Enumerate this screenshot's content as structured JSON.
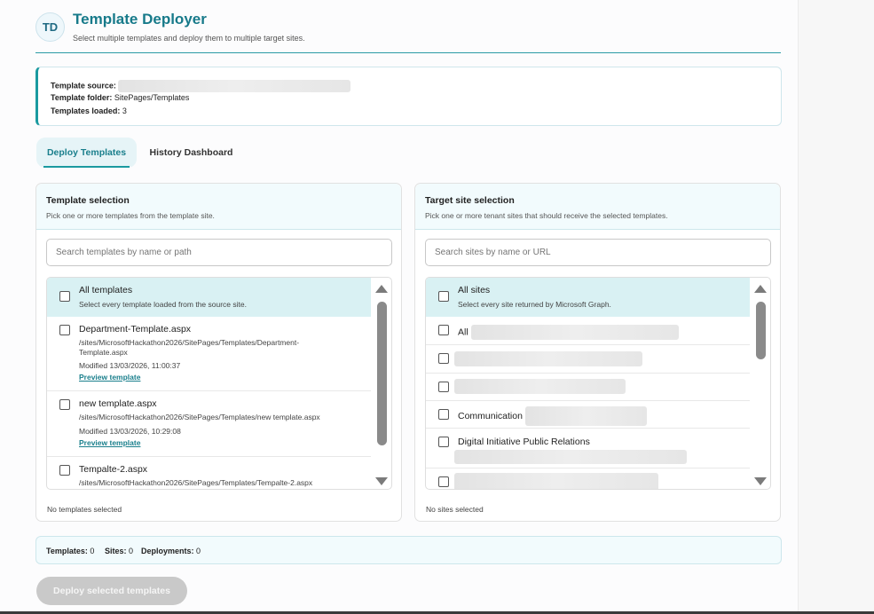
{
  "header": {
    "logo": "TD",
    "title": "Template Deployer",
    "subtitle": "Select multiple templates and deploy them to multiple target sites."
  },
  "info": {
    "source_label": "Template source:",
    "source_value": "",
    "folder_label": "Template folder:",
    "folder_value": "SitePages/Templates",
    "loaded_label": "Templates loaded:",
    "loaded_value": "3"
  },
  "tabs": [
    {
      "label": "Deploy Templates",
      "active": true
    },
    {
      "label": "History Dashboard",
      "active": false
    }
  ],
  "template_panel": {
    "title": "Template selection",
    "subtitle": "Pick one or more templates from the template site.",
    "search_placeholder": "Search templates by name or path",
    "all_item": {
      "title": "All templates",
      "desc": "Select every template loaded from the source site."
    },
    "items": [
      {
        "title": "Department-Template.aspx",
        "path": "/sites/MicrosoftHackathon2026/SitePages/Templates/Department-Template.aspx",
        "modified": "Modified 13/03/2026, 11:00:37",
        "link": "Preview template"
      },
      {
        "title": "new template.aspx",
        "path": "/sites/MicrosoftHackathon2026/SitePages/Templates/new template.aspx",
        "modified": "Modified 13/03/2026, 10:29:08",
        "link": "Preview template"
      },
      {
        "title": "Tempalte-2.aspx",
        "path": "/sites/MicrosoftHackathon2026/SitePages/Templates/Tempalte-2.aspx"
      }
    ],
    "status": "No templates selected"
  },
  "site_panel": {
    "title": "Target site selection",
    "subtitle": "Pick one or more tenant sites that should receive the selected templates.",
    "search_placeholder": "Search sites by name or URL",
    "all_item": {
      "title": "All sites",
      "desc": "Select every site returned by Microsoft Graph."
    },
    "items": [
      {
        "title": "All"
      },
      {
        "title": ""
      },
      {
        "title": ""
      },
      {
        "title": "Communication"
      },
      {
        "title": "Digital Initiative Public Relations"
      },
      {
        "title": ""
      }
    ],
    "status": "No sites selected"
  },
  "summary": {
    "templates_label": "Templates:",
    "templates_value": "0",
    "sites_label": "Sites:",
    "sites_value": "0",
    "deployments_label": "Deployments:",
    "deployments_value": "0"
  },
  "deploy_button": "Deploy selected templates",
  "colors": {
    "accent": "#1a9aa0",
    "title": "#177a8a",
    "selected_row": "#d9f1f3",
    "disabled_button": "#c9c9c9"
  }
}
